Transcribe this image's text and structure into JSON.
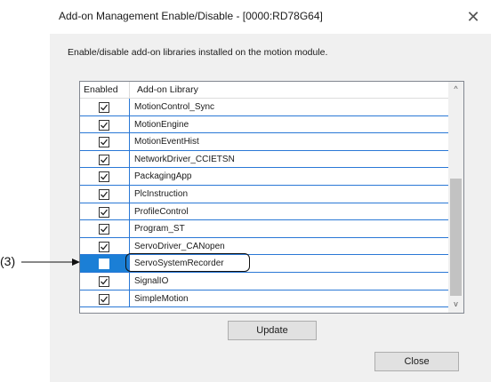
{
  "window": {
    "title": "Add-on Management  Enable/Disable - [0000:RD78G64]",
    "close_glyph": "✕"
  },
  "description": "Enable/disable add-on libraries installed on the motion module.",
  "table": {
    "columns": [
      "Enabled",
      "Add-on Library"
    ],
    "rows": [
      {
        "enabled": true,
        "name": "MotionControl_Sync"
      },
      {
        "enabled": true,
        "name": "MotionEngine"
      },
      {
        "enabled": true,
        "name": "MotionEventHist"
      },
      {
        "enabled": true,
        "name": "NetworkDriver_CCIETSN"
      },
      {
        "enabled": true,
        "name": "PackagingApp"
      },
      {
        "enabled": true,
        "name": "PlcInstruction"
      },
      {
        "enabled": true,
        "name": "ProfileControl"
      },
      {
        "enabled": true,
        "name": "Program_ST"
      },
      {
        "enabled": true,
        "name": "ServoDriver_CANopen"
      },
      {
        "enabled": false,
        "name": "ServoSystemRecorder",
        "selected": true
      },
      {
        "enabled": true,
        "name": "SignalIO"
      },
      {
        "enabled": true,
        "name": "SimpleMotion"
      }
    ]
  },
  "scrollbar": {
    "up_glyph": "^",
    "down_glyph": "v"
  },
  "buttons": {
    "update": "Update",
    "close": "Close"
  },
  "annotation": {
    "label": "(3)"
  },
  "colors": {
    "selection": "#1b7fd6",
    "grid": "#2a78d6",
    "dialog_bg": "#f0f0f0"
  }
}
